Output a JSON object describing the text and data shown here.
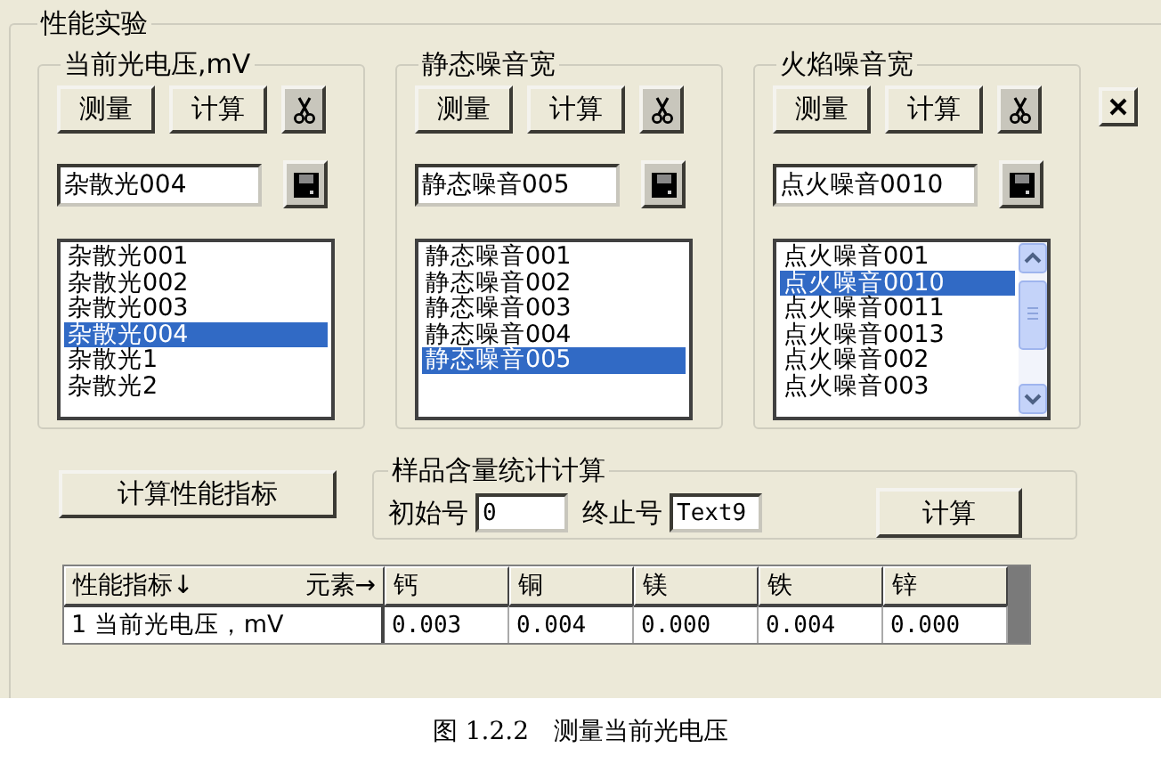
{
  "group_title": "性能实验",
  "panels": [
    {
      "title": "当前光电压,mV",
      "buttons": [
        "测量",
        "计算"
      ],
      "field_value": "杂散光004",
      "scrollbar": false,
      "items": [
        {
          "label": "杂散光001",
          "selected": false
        },
        {
          "label": "杂散光002",
          "selected": false
        },
        {
          "label": "杂散光003",
          "selected": false
        },
        {
          "label": "杂散光004",
          "selected": true
        },
        {
          "label": "杂散光1",
          "selected": false
        },
        {
          "label": "杂散光2",
          "selected": false
        }
      ]
    },
    {
      "title": "静态噪音宽",
      "buttons": [
        "测量",
        "计算"
      ],
      "field_value": "静态噪音005",
      "scrollbar": false,
      "items": [
        {
          "label": "静态噪音001",
          "selected": false
        },
        {
          "label": "静态噪音002",
          "selected": false
        },
        {
          "label": "静态噪音003",
          "selected": false
        },
        {
          "label": "静态噪音004",
          "selected": false
        },
        {
          "label": "静态噪音005",
          "selected": true
        }
      ]
    },
    {
      "title": "火焰噪音宽",
      "buttons": [
        "测量",
        "计算"
      ],
      "field_value": "点火噪音0010",
      "scrollbar": true,
      "items": [
        {
          "label": "点火噪音001",
          "selected": false
        },
        {
          "label": "点火噪音0010",
          "selected": true
        },
        {
          "label": "点火噪音0011",
          "selected": false
        },
        {
          "label": "点火噪音0013",
          "selected": false
        },
        {
          "label": "点火噪音002",
          "selected": false
        },
        {
          "label": "点火噪音003",
          "selected": false
        }
      ]
    }
  ],
  "compute_button": "计算性能指标",
  "stats": {
    "title": "样品含量统计计算",
    "start_label": "初始号",
    "start_value": "0",
    "end_label": "终止号",
    "end_value": "Text9",
    "button": "计算"
  },
  "table": {
    "row_header": "性能指标↓",
    "column_header": "元素→",
    "columns": [
      "钙",
      "铜",
      "镁",
      "铁",
      "锌"
    ],
    "rows": [
      {
        "label": "1 当前光电压，mV",
        "cells": [
          "0.003",
          "0.004",
          "0.000",
          "0.004",
          "0.000"
        ]
      }
    ]
  },
  "caption": "图 1.2.2　测量当前光电压"
}
